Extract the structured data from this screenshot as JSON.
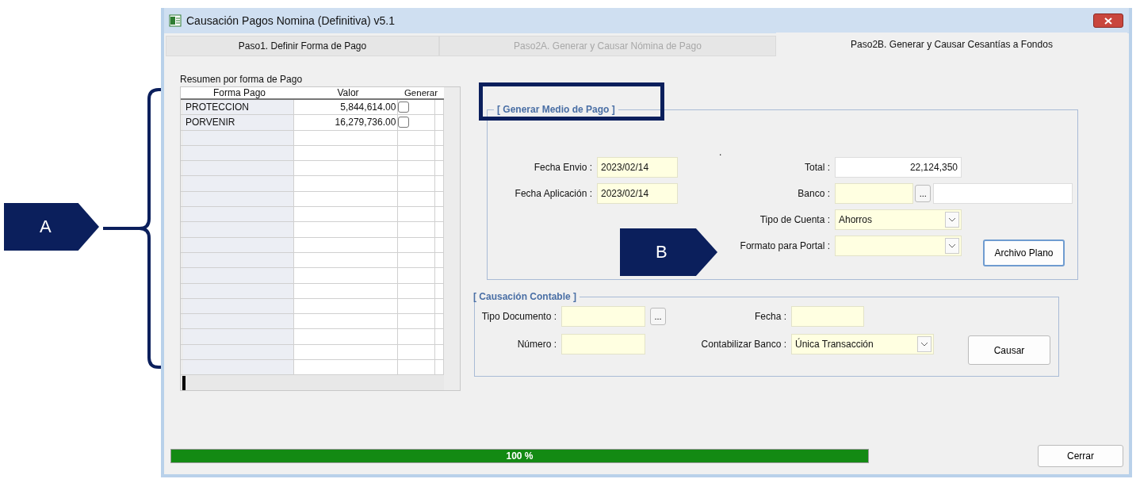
{
  "annotations": [
    {
      "kind": "bracket-callout",
      "label": "A"
    },
    {
      "kind": "arrow-callout",
      "label": "B"
    }
  ],
  "window": {
    "title": "Causación Pagos Nomina (Definitiva) v5.1"
  },
  "tabs": [
    {
      "label": "Paso1. Definir Forma de Pago",
      "selected": false,
      "disabled": false
    },
    {
      "label": "Paso2A. Generar y Causar Nómina de Pago",
      "selected": false,
      "disabled": true
    },
    {
      "label": "Paso2B. Generar y Causar Cesantías a Fondos",
      "selected": true,
      "disabled": false
    }
  ],
  "summary": {
    "title": "Resumen por forma de Pago",
    "columns": [
      "Forma Pago",
      "Valor",
      "Generar"
    ],
    "rows": [
      {
        "forma_pago": "PROTECCION",
        "valor": "5,844,614.00",
        "generar": false
      },
      {
        "forma_pago": "PORVENIR",
        "valor": "16,279,736.00",
        "generar": false
      }
    ]
  },
  "medio_pago": {
    "title": "[ Generar Medio de Pago ]",
    "marker": ".",
    "fecha_envio": {
      "label": "Fecha Envio :",
      "value": "2023/02/14"
    },
    "fecha_aplicacion": {
      "label": "Fecha Aplicación :",
      "value": "2023/02/14"
    },
    "total": {
      "label": "Total :",
      "value": "22,124,350"
    },
    "banco": {
      "label": "Banco :",
      "browse": "..."
    },
    "tipo_cuenta": {
      "label": "Tipo de Cuenta :",
      "value": "Ahorros"
    },
    "formato_portal": {
      "label": "Formato para Portal :"
    },
    "button": "Archivo Plano"
  },
  "causacion": {
    "title": "[ Causación Contable ]",
    "tipo_documento": {
      "label": "Tipo Documento :",
      "browse": "..."
    },
    "fecha": {
      "label": "Fecha :"
    },
    "numero": {
      "label": "Número :"
    },
    "contabilizar_banco": {
      "label": "Contabilizar Banco :",
      "value": "Única Transacción"
    },
    "button": "Causar"
  },
  "progress": {
    "level": 1,
    "text": "100 %"
  },
  "close_button": "Cerrar"
}
